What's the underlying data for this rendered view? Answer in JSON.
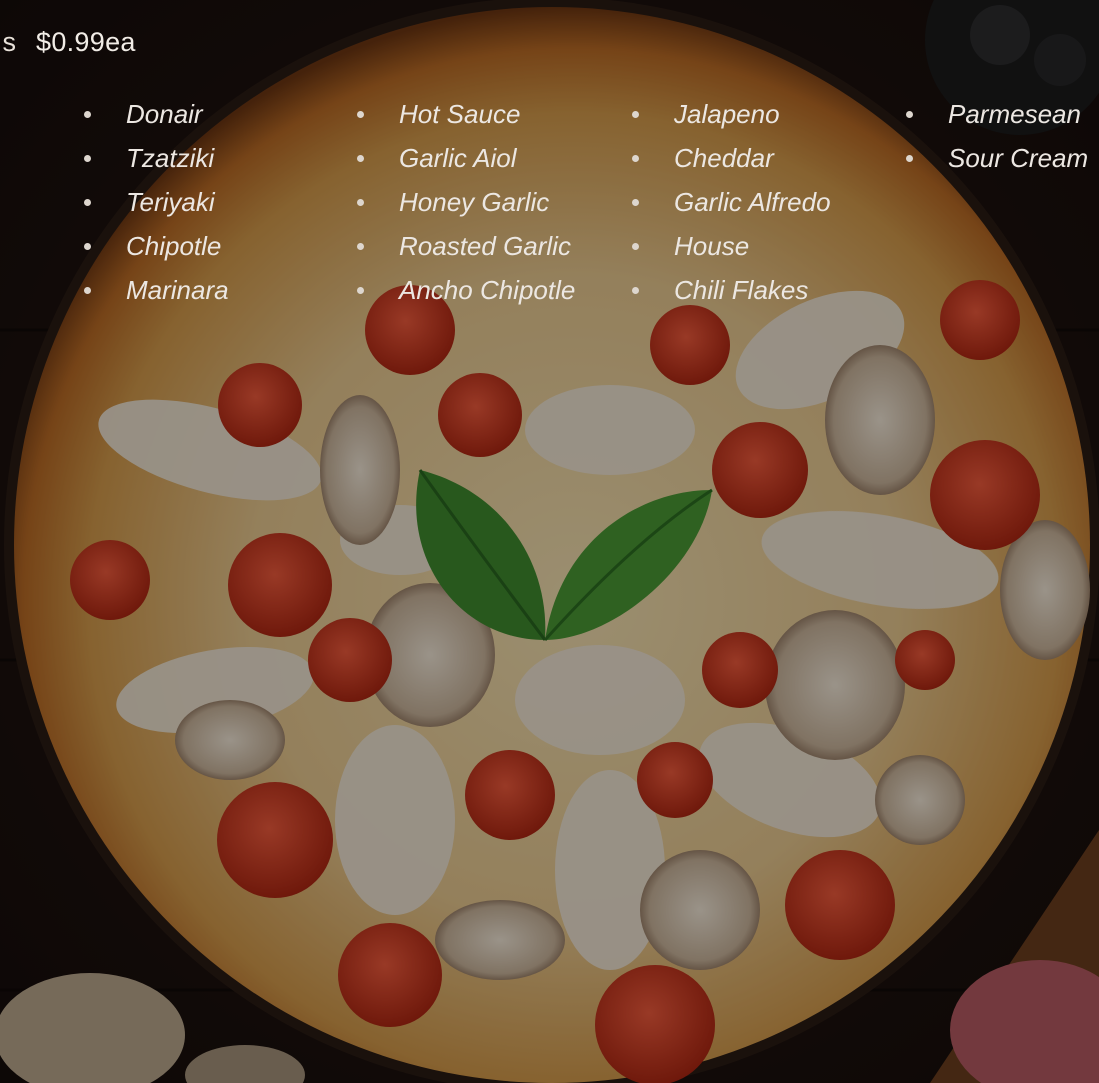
{
  "header": {
    "price_prefix": "s",
    "price": "$0.99ea"
  },
  "columns": [
    [
      "Donair",
      "Tzatziki",
      "Teriyaki",
      "Chipotle",
      "Marinara"
    ],
    [
      "Hot Sauce",
      "Garlic Aiol",
      "Honey Garlic",
      "Roasted Garlic",
      "Ancho Chipotle"
    ],
    [
      "Jalapeno",
      "Cheddar",
      "Garlic Alfredo",
      "House",
      "Chili Flakes"
    ],
    [
      "Parmesean",
      "Sour Cream"
    ]
  ],
  "colors": {
    "background": "#1a1210",
    "text": "#ece7e2",
    "crust": "#b0651f",
    "cheese": "#e9c98d",
    "tomato": "#c8321f",
    "basil": "#3f8a2e"
  }
}
